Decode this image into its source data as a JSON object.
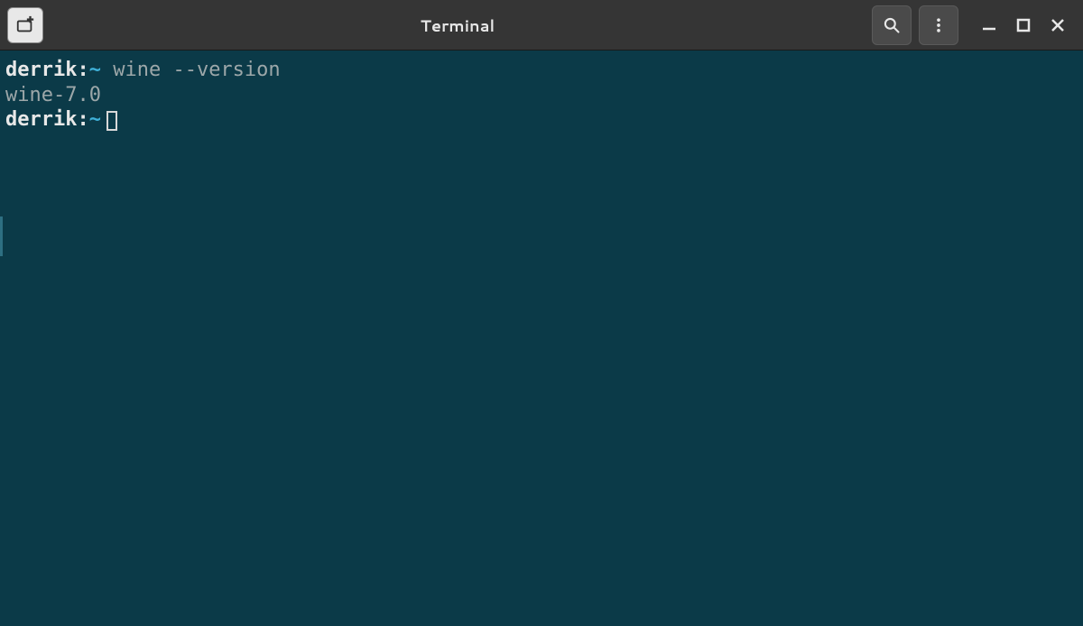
{
  "titlebar": {
    "title": "Terminal"
  },
  "terminal": {
    "lines": [
      {
        "user": "derrik",
        "colon": ":",
        "path": "~",
        "command": " wine --version"
      },
      {
        "output": "wine-7.0"
      },
      {
        "user": "derrik",
        "colon": ":",
        "path": "~"
      }
    ]
  }
}
